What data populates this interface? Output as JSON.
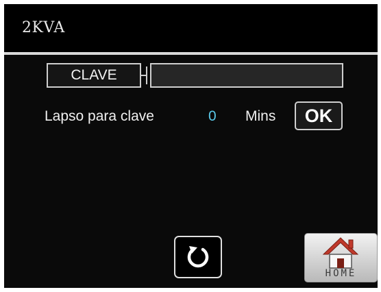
{
  "header": {
    "title": "2KVA"
  },
  "password": {
    "label": "CLAVE",
    "value": ""
  },
  "timeout": {
    "label": "Lapso para clave",
    "value": "0",
    "unit": "Mins"
  },
  "actions": {
    "ok_label": "OK",
    "home_label": "HOME"
  },
  "icons": {
    "refresh": "refresh-icon",
    "home": "home-icon"
  },
  "colors": {
    "background": "#0a0a0a",
    "value_accent": "#5ac8e8",
    "home_roof": "#c0392b"
  }
}
